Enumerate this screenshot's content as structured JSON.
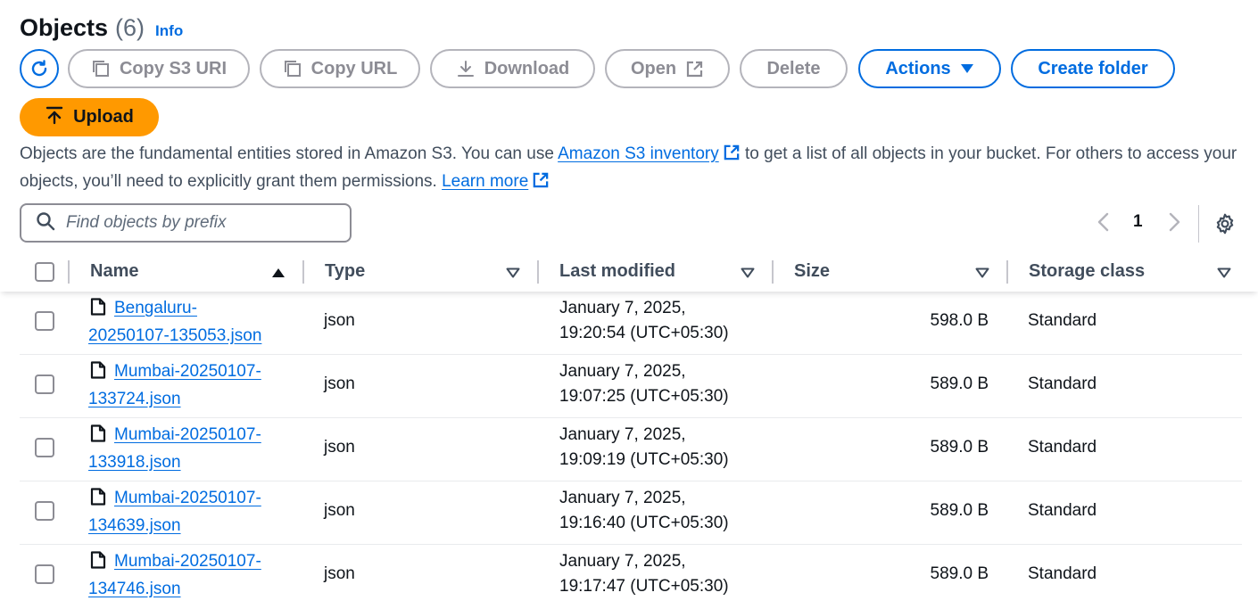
{
  "header": {
    "title": "Objects",
    "count": "(6)",
    "info": "Info"
  },
  "toolbar": {
    "copy_s3_uri": "Copy S3 URI",
    "copy_url": "Copy URL",
    "download": "Download",
    "open": "Open",
    "delete": "Delete",
    "actions": "Actions",
    "create_folder": "Create folder",
    "upload": "Upload"
  },
  "description": {
    "part1": "Objects are the fundamental entities stored in Amazon S3. You can use ",
    "link1": "Amazon S3 inventory",
    "part2": " to get a list of all objects in your bucket. For others to access your objects, you’ll need to explicitly grant them permissions. ",
    "link2": "Learn more"
  },
  "search": {
    "placeholder": "Find objects by prefix"
  },
  "pagination": {
    "page": "1"
  },
  "columns": [
    "Name",
    "Type",
    "Last modified",
    "Size",
    "Storage class"
  ],
  "rows": [
    {
      "name": "Bengaluru-20250107-135053.json",
      "name_line1": "Bengaluru-",
      "name_line2": "20250107-135053.json",
      "type": "json",
      "modified_line1": "January 7, 2025,",
      "modified_line2": "19:20:54 (UTC+05:30)",
      "size": "598.0 B",
      "storage": "Standard"
    },
    {
      "name": "Mumbai-20250107-133724.json",
      "name_line1": "Mumbai-20250107-",
      "name_line2": "133724.json",
      "type": "json",
      "modified_line1": "January 7, 2025,",
      "modified_line2": "19:07:25 (UTC+05:30)",
      "size": "589.0 B",
      "storage": "Standard"
    },
    {
      "name": "Mumbai-20250107-133918.json",
      "name_line1": "Mumbai-20250107-",
      "name_line2": "133918.json",
      "type": "json",
      "modified_line1": "January 7, 2025,",
      "modified_line2": "19:09:19 (UTC+05:30)",
      "size": "589.0 B",
      "storage": "Standard"
    },
    {
      "name": "Mumbai-20250107-134639.json",
      "name_line1": "Mumbai-20250107-",
      "name_line2": "134639.json",
      "type": "json",
      "modified_line1": "January 7, 2025,",
      "modified_line2": "19:16:40 (UTC+05:30)",
      "size": "589.0 B",
      "storage": "Standard"
    },
    {
      "name": "Mumbai-20250107-134746.json",
      "name_line1": "Mumbai-20250107-",
      "name_line2": "134746.json",
      "type": "json",
      "modified_line1": "January 7, 2025,",
      "modified_line2": "19:17:47 (UTC+05:30)",
      "size": "589.0 B",
      "storage": "Standard"
    }
  ],
  "colors": {
    "link": "#006ce0",
    "upload_bg": "#ff9900",
    "disabled": "#8c8c94",
    "text": "#0f141a"
  },
  "icons": [
    "refresh-icon",
    "copy-icon",
    "download-icon",
    "external-link-icon",
    "caret-down-icon",
    "upload-arrow-icon",
    "search-icon",
    "chevron-left-icon",
    "chevron-right-icon",
    "gear-icon",
    "sort-up-icon",
    "sort-down-icon",
    "file-icon"
  ]
}
